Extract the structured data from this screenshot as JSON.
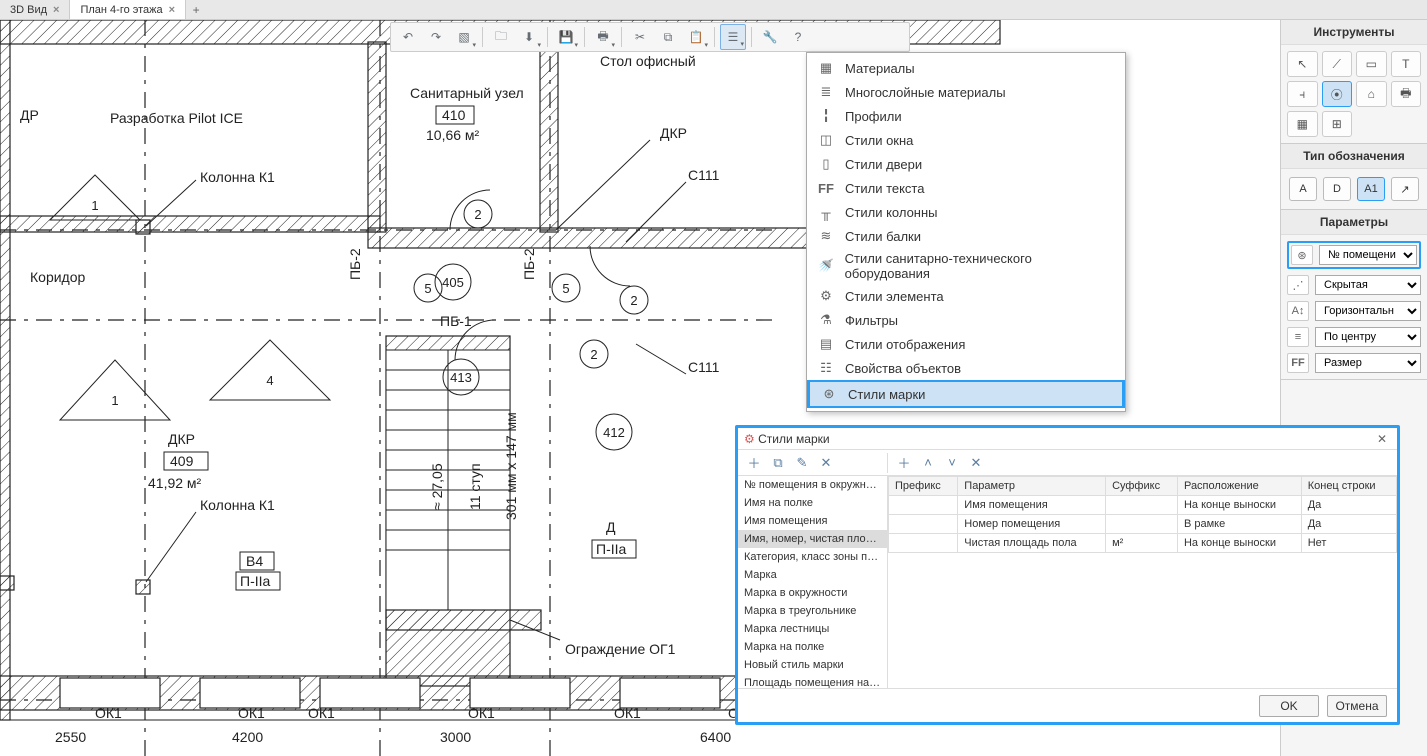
{
  "tabs": [
    {
      "label": "3D Вид",
      "active": false
    },
    {
      "label": "План 4-го этажа",
      "active": true
    }
  ],
  "dropdown": {
    "items": [
      "Материалы",
      "Многослойные материалы",
      "Профили",
      "Стили окна",
      "Стили двери",
      "Стили текста",
      "Стили колонны",
      "Стили балки",
      "Стили санитарно-технического оборудования",
      "Стили элемента",
      "Фильтры",
      "Стили отображения",
      "Свойства объектов",
      "Стили марки"
    ],
    "highlighted_index": 13
  },
  "right": {
    "tools_title": "Инструменты",
    "designation_title": "Тип обозначения",
    "params_title": "Параметры",
    "params": {
      "room_no": "№ помещени",
      "line_style": "Скрытая",
      "orientation": "Горизонтальн",
      "align": "По центру",
      "size_label": "Размер"
    }
  },
  "dialog": {
    "title": "Стили марки",
    "ok": "OK",
    "cancel": "Отмена",
    "list": [
      "№ помещения в окружности",
      "Имя на полке",
      "Имя помещения",
      "Имя, номер, чистая площадь по",
      "Категория, класс зоны помещен",
      "Марка",
      "Марка в окружности",
      "Марка в треугольнике",
      "Марка лестницы",
      "Марка на полке",
      "Новый стиль марки",
      "Площадь помещения на полке"
    ],
    "selected_index": 3,
    "table": {
      "headers": [
        "Префикс",
        "Параметр",
        "Суффикс",
        "Расположение",
        "Конец строки"
      ],
      "rows": [
        [
          "",
          "Имя помещения",
          "",
          "На конце выноски",
          "Да"
        ],
        [
          "",
          "Номер помещения",
          "",
          "В рамке",
          "Да"
        ],
        [
          "",
          "Чистая площадь пола",
          "м²",
          "На конце выноски",
          "Нет"
        ]
      ]
    }
  },
  "floorplan": {
    "labels": {
      "dr": "ДР",
      "pilot": "Разработка Pilot ICE",
      "corridor": "Коридор",
      "col_k1_top": "Колонна К1",
      "col_k1_bot": "Колонна К1",
      "dkr_top": "ДКР",
      "dkr_409": "ДКР",
      "n409": "409",
      "a409": "41,92 м²",
      "san": "Санитарный узел",
      "n410": "410",
      "a410": "10,66 м²",
      "desk": "Стол офисный",
      "pb2_l": "ПБ-2",
      "pb2_r": "ПБ-2",
      "pb1": "ПБ-1",
      "c111a": "С111",
      "c111b": "С111",
      "n405": "405",
      "n413": "413",
      "n412": "412",
      "stair_h": "≈ 27,05",
      "stair_steps": "11 ступ",
      "stair_d": "301 мм x 147 мм",
      "d_label": "Д",
      "p2a": "П-IIа",
      "b4": "В4",
      "p2a2": "П-IIа",
      "fence": "Ограждение ОГ1",
      "ok1": "ОК1",
      "d2550": "2550",
      "d4200": "4200",
      "d3000": "3000",
      "d6400": "6400",
      "t1": "1",
      "t2": "2",
      "t5": "5"
    }
  }
}
